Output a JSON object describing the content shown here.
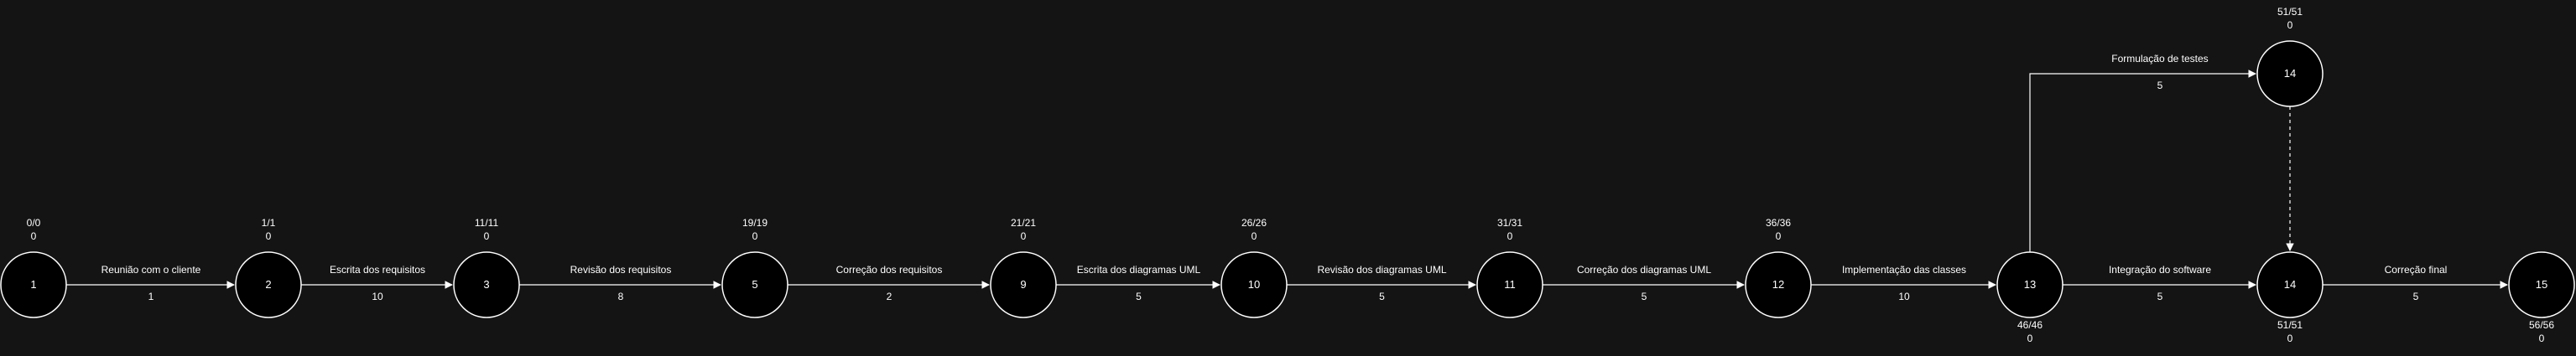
{
  "nodes": [
    {
      "id": "n1",
      "label": "1",
      "es_ls": "0/0",
      "slack": "0"
    },
    {
      "id": "n2",
      "label": "2",
      "es_ls": "1/1",
      "slack": "0"
    },
    {
      "id": "n3",
      "label": "3",
      "es_ls": "11/11",
      "slack": "0"
    },
    {
      "id": "n5",
      "label": "5",
      "es_ls": "19/19",
      "slack": "0"
    },
    {
      "id": "n9",
      "label": "9",
      "es_ls": "21/21",
      "slack": "0"
    },
    {
      "id": "n10",
      "label": "10",
      "es_ls": "26/26",
      "slack": "0"
    },
    {
      "id": "n11",
      "label": "11",
      "es_ls": "31/31",
      "slack": "0"
    },
    {
      "id": "n12",
      "label": "12",
      "es_ls": "36/36",
      "slack": "0"
    },
    {
      "id": "n13",
      "label": "13",
      "es_ls": "46/46",
      "slack": "0"
    },
    {
      "id": "n14top",
      "label": "14",
      "es_ls": "51/51",
      "slack": "0"
    },
    {
      "id": "n14",
      "label": "14",
      "es_ls": "51/51",
      "slack": "0"
    },
    {
      "id": "n15",
      "label": "15",
      "es_ls": "56/56",
      "slack": "0"
    }
  ],
  "edges": [
    {
      "id": "e1",
      "from": "n1",
      "to": "n2",
      "name": "Reunião com o cliente",
      "duration": "1"
    },
    {
      "id": "e2",
      "from": "n2",
      "to": "n3",
      "name": "Escrita dos requisitos",
      "duration": "10"
    },
    {
      "id": "e3",
      "from": "n3",
      "to": "n5",
      "name": "Revisão dos requisitos",
      "duration": "8"
    },
    {
      "id": "e4",
      "from": "n5",
      "to": "n9",
      "name": "Correção dos requisitos",
      "duration": "2"
    },
    {
      "id": "e5",
      "from": "n9",
      "to": "n10",
      "name": "Escrita dos diagramas UML",
      "duration": "5"
    },
    {
      "id": "e6",
      "from": "n10",
      "to": "n11",
      "name": "Revisão dos diagramas UML",
      "duration": "5"
    },
    {
      "id": "e7",
      "from": "n11",
      "to": "n12",
      "name": "Correção dos diagramas UML",
      "duration": "5"
    },
    {
      "id": "e8",
      "from": "n12",
      "to": "n13",
      "name": "Implementação das classes",
      "duration": "10"
    },
    {
      "id": "e9",
      "from": "n13",
      "to": "n14",
      "name": "Integração do software",
      "duration": "5"
    },
    {
      "id": "e10",
      "from": "n14",
      "to": "n15",
      "name": "Correção final",
      "duration": "5"
    },
    {
      "id": "e11",
      "from": "n13",
      "to": "n14top",
      "name": "Formulação de testes",
      "duration": "5"
    },
    {
      "id": "e12",
      "from": "n14top",
      "to": "n14",
      "name": "",
      "duration": "",
      "dashed": true
    }
  ]
}
